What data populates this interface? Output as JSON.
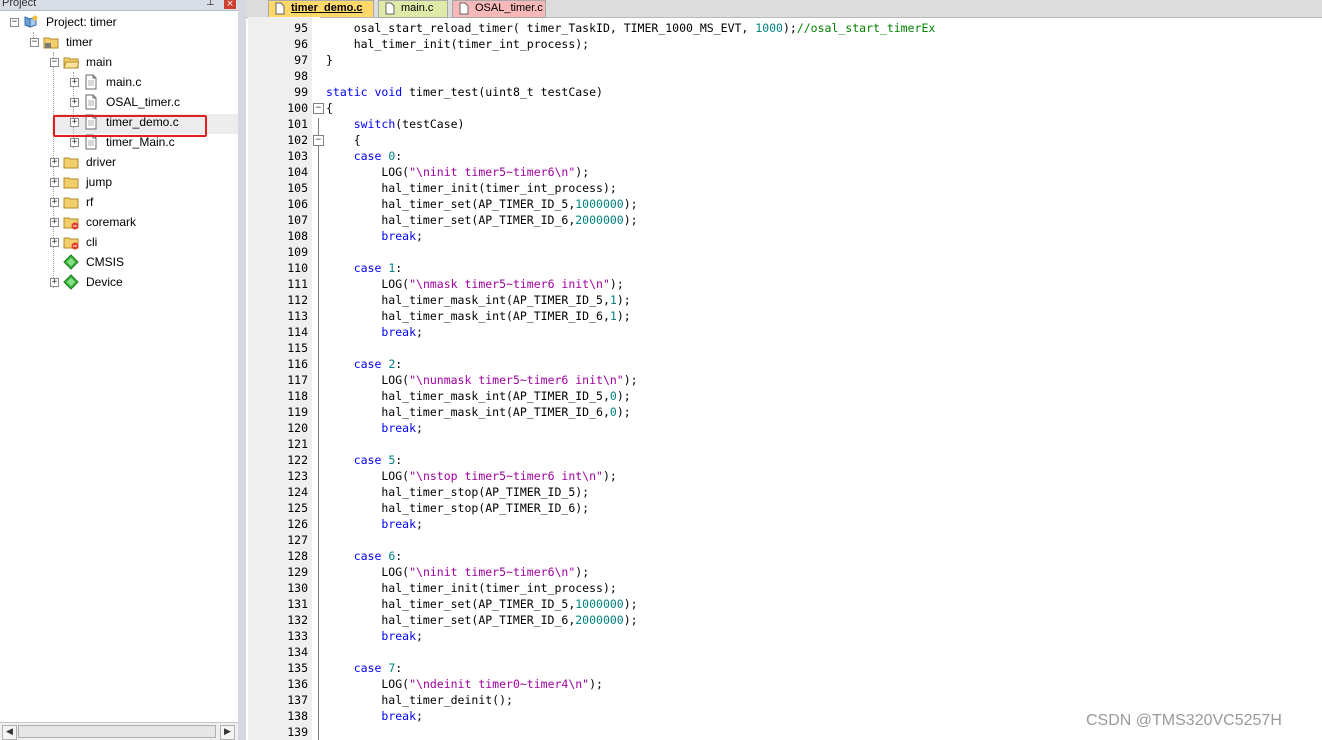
{
  "project_panel": {
    "title": "Project",
    "pin_glyph": "⊥",
    "close_glyph": "×",
    "root": "Project: timer",
    "target": "timer",
    "group_main": "main",
    "files": [
      "main.c",
      "OSAL_timer.c",
      "timer_demo.c",
      "timer_Main.c"
    ],
    "groups": [
      "driver",
      "jump",
      "rf",
      "coremark",
      "cli"
    ],
    "components": [
      "CMSIS",
      "Device"
    ],
    "selected_file": "timer_demo.c",
    "highlight_color": "#e02020"
  },
  "tabs": [
    {
      "label": "timer_demo.c",
      "active": true,
      "color": "#ffd86a"
    },
    {
      "label": "main.c",
      "active": false,
      "color": "#dfe9a8"
    },
    {
      "label": "OSAL_timer.c",
      "active": false,
      "color": "#f6b8b8"
    }
  ],
  "editor": {
    "lines": [
      {
        "num": "95",
        "code": [
          [
            "    osal_start_reload_timer( timer_TaskID, TIMER_1000_MS_EVT, ",
            ""
          ],
          [
            "1000",
            "n"
          ],
          [
            ");",
            ""
          ],
          [
            "//osal_start_timerEx",
            "c"
          ]
        ]
      },
      {
        "num": "96",
        "code": [
          [
            "    hal_timer_init(timer_int_process);",
            ""
          ]
        ]
      },
      {
        "num": "97",
        "code": [
          [
            "}",
            ""
          ]
        ]
      },
      {
        "num": "98",
        "code": [
          [
            "",
            ""
          ]
        ]
      },
      {
        "num": "99",
        "code": [
          [
            "static",
            "k"
          ],
          [
            " ",
            ""
          ],
          [
            "void",
            "k"
          ],
          [
            " timer_test(uint8_t testCase)",
            ""
          ]
        ]
      },
      {
        "num": "100",
        "code": [
          [
            "{",
            ""
          ]
        ]
      },
      {
        "num": "101",
        "code": [
          [
            "    ",
            ""
          ],
          [
            "switch",
            "k"
          ],
          [
            "(testCase)",
            ""
          ]
        ]
      },
      {
        "num": "102",
        "code": [
          [
            "    {",
            ""
          ]
        ]
      },
      {
        "num": "103",
        "code": [
          [
            "    ",
            ""
          ],
          [
            "case",
            "k"
          ],
          [
            " ",
            ""
          ],
          [
            "0",
            "n"
          ],
          [
            ":",
            ""
          ]
        ]
      },
      {
        "num": "104",
        "code": [
          [
            "        LOG(",
            ""
          ],
          [
            "\"\\ninit timer5~timer6\\n\"",
            "s"
          ],
          [
            ");",
            ""
          ]
        ]
      },
      {
        "num": "105",
        "code": [
          [
            "        hal_timer_init(timer_int_process);",
            ""
          ]
        ]
      },
      {
        "num": "106",
        "code": [
          [
            "        hal_timer_set(AP_TIMER_ID_5,",
            ""
          ],
          [
            "1000000",
            "n"
          ],
          [
            ");",
            ""
          ]
        ]
      },
      {
        "num": "107",
        "code": [
          [
            "        hal_timer_set(AP_TIMER_ID_6,",
            ""
          ],
          [
            "2000000",
            "n"
          ],
          [
            ");",
            ""
          ]
        ]
      },
      {
        "num": "108",
        "code": [
          [
            "        ",
            ""
          ],
          [
            "break",
            "k"
          ],
          [
            ";",
            ""
          ]
        ]
      },
      {
        "num": "109",
        "code": [
          [
            "",
            ""
          ]
        ]
      },
      {
        "num": "110",
        "code": [
          [
            "    ",
            ""
          ],
          [
            "case",
            "k"
          ],
          [
            " ",
            ""
          ],
          [
            "1",
            "n"
          ],
          [
            ":",
            ""
          ]
        ]
      },
      {
        "num": "111",
        "code": [
          [
            "        LOG(",
            ""
          ],
          [
            "\"\\nmask timer5~timer6 init\\n\"",
            "s"
          ],
          [
            ");",
            ""
          ]
        ]
      },
      {
        "num": "112",
        "code": [
          [
            "        hal_timer_mask_int(AP_TIMER_ID_5,",
            ""
          ],
          [
            "1",
            "n"
          ],
          [
            ");",
            ""
          ]
        ]
      },
      {
        "num": "113",
        "code": [
          [
            "        hal_timer_mask_int(AP_TIMER_ID_6,",
            ""
          ],
          [
            "1",
            "n"
          ],
          [
            ");",
            ""
          ]
        ]
      },
      {
        "num": "114",
        "code": [
          [
            "        ",
            ""
          ],
          [
            "break",
            "k"
          ],
          [
            ";",
            ""
          ]
        ]
      },
      {
        "num": "115",
        "code": [
          [
            "",
            ""
          ]
        ]
      },
      {
        "num": "116",
        "code": [
          [
            "    ",
            ""
          ],
          [
            "case",
            "k"
          ],
          [
            " ",
            ""
          ],
          [
            "2",
            "n"
          ],
          [
            ":",
            ""
          ]
        ]
      },
      {
        "num": "117",
        "code": [
          [
            "        LOG(",
            ""
          ],
          [
            "\"\\nunmask timer5~timer6 init\\n\"",
            "s"
          ],
          [
            ");",
            ""
          ]
        ]
      },
      {
        "num": "118",
        "code": [
          [
            "        hal_timer_mask_int(AP_TIMER_ID_5,",
            ""
          ],
          [
            "0",
            "n"
          ],
          [
            ");",
            ""
          ]
        ]
      },
      {
        "num": "119",
        "code": [
          [
            "        hal_timer_mask_int(AP_TIMER_ID_6,",
            ""
          ],
          [
            "0",
            "n"
          ],
          [
            ");",
            ""
          ]
        ]
      },
      {
        "num": "120",
        "code": [
          [
            "        ",
            ""
          ],
          [
            "break",
            "k"
          ],
          [
            ";",
            ""
          ]
        ]
      },
      {
        "num": "121",
        "code": [
          [
            "",
            ""
          ]
        ]
      },
      {
        "num": "122",
        "code": [
          [
            "    ",
            ""
          ],
          [
            "case",
            "k"
          ],
          [
            " ",
            ""
          ],
          [
            "5",
            "n"
          ],
          [
            ":",
            ""
          ]
        ]
      },
      {
        "num": "123",
        "code": [
          [
            "        LOG(",
            ""
          ],
          [
            "\"\\nstop timer5~timer6 int\\n\"",
            "s"
          ],
          [
            ");",
            ""
          ]
        ]
      },
      {
        "num": "124",
        "code": [
          [
            "        hal_timer_stop(AP_TIMER_ID_5);",
            ""
          ]
        ]
      },
      {
        "num": "125",
        "code": [
          [
            "        hal_timer_stop(AP_TIMER_ID_6);",
            ""
          ]
        ]
      },
      {
        "num": "126",
        "code": [
          [
            "        ",
            ""
          ],
          [
            "break",
            "k"
          ],
          [
            ";",
            ""
          ]
        ]
      },
      {
        "num": "127",
        "code": [
          [
            "",
            ""
          ]
        ]
      },
      {
        "num": "128",
        "code": [
          [
            "    ",
            ""
          ],
          [
            "case",
            "k"
          ],
          [
            " ",
            ""
          ],
          [
            "6",
            "n"
          ],
          [
            ":",
            ""
          ]
        ]
      },
      {
        "num": "129",
        "code": [
          [
            "        LOG(",
            ""
          ],
          [
            "\"\\ninit timer5~timer6\\n\"",
            "s"
          ],
          [
            ");",
            ""
          ]
        ]
      },
      {
        "num": "130",
        "code": [
          [
            "        hal_timer_init(timer_int_process);",
            ""
          ]
        ]
      },
      {
        "num": "131",
        "code": [
          [
            "        hal_timer_set(AP_TIMER_ID_5,",
            ""
          ],
          [
            "1000000",
            "n"
          ],
          [
            ");",
            ""
          ]
        ]
      },
      {
        "num": "132",
        "code": [
          [
            "        hal_timer_set(AP_TIMER_ID_6,",
            ""
          ],
          [
            "2000000",
            "n"
          ],
          [
            ");",
            ""
          ]
        ]
      },
      {
        "num": "133",
        "code": [
          [
            "        ",
            ""
          ],
          [
            "break",
            "k"
          ],
          [
            ";",
            ""
          ]
        ]
      },
      {
        "num": "134",
        "code": [
          [
            "",
            ""
          ]
        ]
      },
      {
        "num": "135",
        "code": [
          [
            "    ",
            ""
          ],
          [
            "case",
            "k"
          ],
          [
            " ",
            ""
          ],
          [
            "7",
            "n"
          ],
          [
            ":",
            ""
          ]
        ]
      },
      {
        "num": "136",
        "code": [
          [
            "        LOG(",
            ""
          ],
          [
            "\"\\ndeinit timer0~timer4\\n\"",
            "s"
          ],
          [
            ");",
            ""
          ]
        ]
      },
      {
        "num": "137",
        "code": [
          [
            "        hal_timer_deinit();",
            ""
          ]
        ]
      },
      {
        "num": "138",
        "code": [
          [
            "        ",
            ""
          ],
          [
            "break",
            "k"
          ],
          [
            ";",
            ""
          ]
        ]
      },
      {
        "num": "139",
        "code": [
          [
            "",
            ""
          ]
        ]
      }
    ]
  },
  "watermark": "CSDN @TMS320VC5257H"
}
